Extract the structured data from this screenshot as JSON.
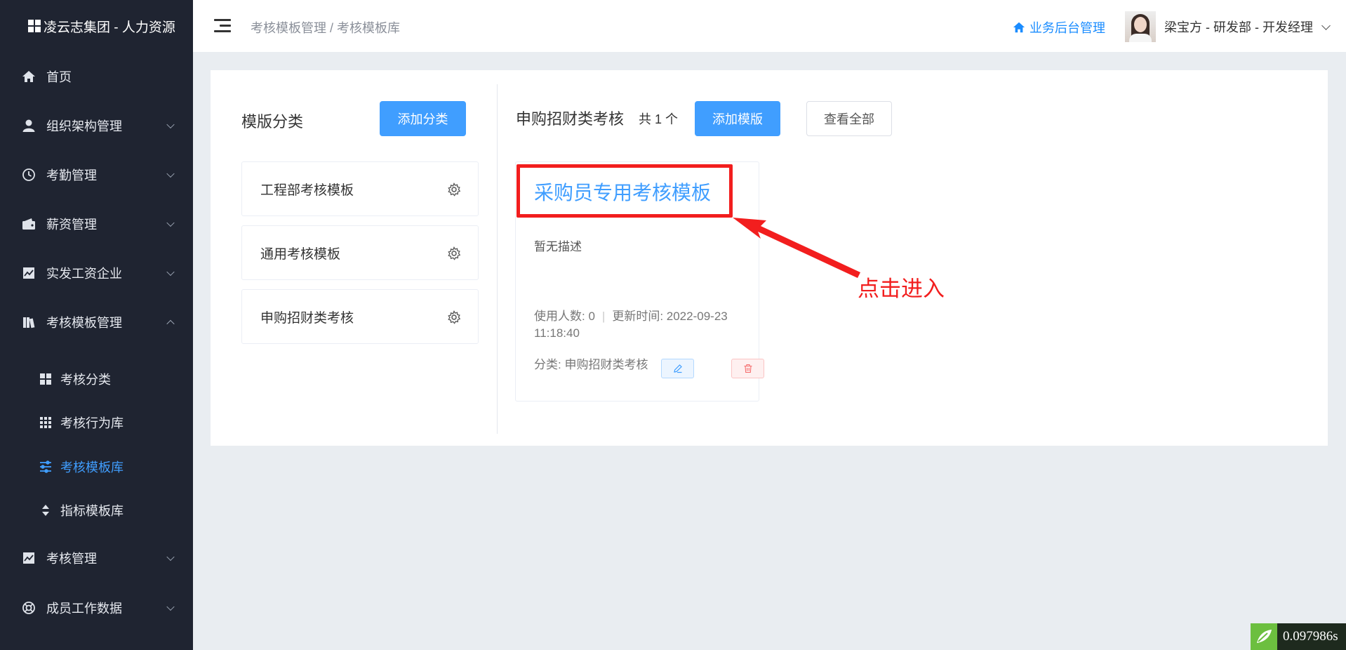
{
  "app": {
    "title": "凌云志集团 - 人力资源"
  },
  "sidebar": {
    "items": [
      {
        "label": "首页",
        "icon": "home-icon"
      },
      {
        "label": "组织架构管理",
        "icon": "user-icon"
      },
      {
        "label": "考勤管理",
        "icon": "clock-icon"
      },
      {
        "label": "薪资管理",
        "icon": "wallet-icon"
      },
      {
        "label": "实发工资企业",
        "icon": "chart-line-icon"
      },
      {
        "label": "考核模板管理",
        "icon": "book-icon"
      },
      {
        "label": "考核管理",
        "icon": "chart-line-icon"
      },
      {
        "label": "成员工作数据",
        "icon": "lifebuoy-icon"
      }
    ],
    "subitems": [
      {
        "label": "考核分类",
        "icon": "grid-4-icon"
      },
      {
        "label": "考核行为库",
        "icon": "grid-9-icon"
      },
      {
        "label": "考核模板库",
        "icon": "sliders-icon",
        "active": true
      },
      {
        "label": "指标模板库",
        "icon": "sort-icon"
      }
    ]
  },
  "header": {
    "breadcrumb": "考核模板管理 / 考核模板库",
    "biz_link": "业务后台管理",
    "user": "梁宝方 - 研发部 - 开发经理"
  },
  "categories": {
    "title": "模版分类",
    "add_button": "添加分类",
    "items": [
      "工程部考核模板",
      "通用考核模板",
      "申购招财类考核"
    ]
  },
  "templates": {
    "current_category": "申购招财类考核",
    "count_label": "共 1 个",
    "add_button": "添加模版",
    "view_all_button": "查看全部",
    "cards": [
      {
        "title": "采购员专用考核模板",
        "description": "暂无描述",
        "users_label": "使用人数: 0",
        "updated_label": "更新时间: 2022-09-23 11:18:40",
        "category_label": "分类: 申购招财类考核"
      }
    ]
  },
  "annotation": {
    "text": "点击进入",
    "color": "#f21e1e"
  },
  "timer": {
    "value": "0.097986s"
  },
  "colors": {
    "accent": "#409eff",
    "sidebar_bg": "#1f2431",
    "page_bg": "#e9edf1"
  }
}
